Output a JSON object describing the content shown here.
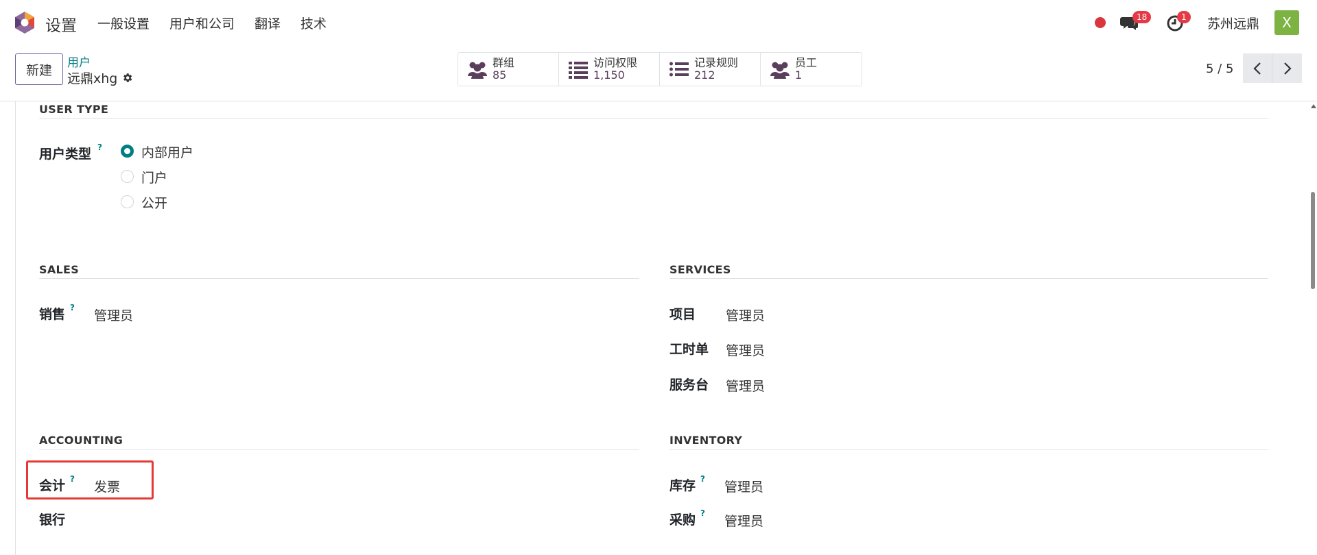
{
  "navbar": {
    "app_title": "设置",
    "menu": [
      "一般设置",
      "用户和公司",
      "翻译",
      "技术"
    ],
    "messages_badge": "18",
    "activity_badge": "1",
    "company": "苏州远鼎",
    "avatar_letter": "X",
    "icons": [
      "odoo-logo-icon",
      "recording-dot-icon",
      "chat-icon",
      "clock-icon"
    ]
  },
  "control": {
    "new_button": "新建",
    "breadcrumb": "用户",
    "record_name": "远鼎xhg",
    "smart_buttons": [
      {
        "label": "群组",
        "value": "85",
        "icon": "users-icon"
      },
      {
        "label": "访问权限",
        "value": "1,150",
        "icon": "list-icon"
      },
      {
        "label": "记录规则",
        "value": "212",
        "icon": "list-icon"
      },
      {
        "label": "员工",
        "value": "1",
        "icon": "users-icon"
      }
    ],
    "pager": "5 / 5"
  },
  "user_type": {
    "title": "USER TYPE",
    "label": "用户类型",
    "help": "?",
    "options": [
      "内部用户",
      "门户",
      "公开"
    ],
    "selected": "内部用户"
  },
  "sales": {
    "title": "SALES",
    "fields": [
      {
        "label": "销售",
        "help": "?",
        "value": "管理员"
      }
    ]
  },
  "services": {
    "title": "SERVICES",
    "fields": [
      {
        "label": "项目",
        "value": "管理员"
      },
      {
        "label": "工时单",
        "value": "管理员"
      },
      {
        "label": "服务台",
        "value": "管理员"
      }
    ]
  },
  "accounting": {
    "title": "ACCOUNTING",
    "fields": [
      {
        "label": "会计",
        "help": "?",
        "value": "发票"
      },
      {
        "label": "银行",
        "value": ""
      }
    ]
  },
  "inventory": {
    "title": "INVENTORY",
    "fields": [
      {
        "label": "库存",
        "help": "?",
        "value": "管理员"
      },
      {
        "label": "采购",
        "help": "?",
        "value": "管理员"
      }
    ]
  },
  "colors": {
    "primary": "#71639e",
    "teal": "#017e84",
    "badge_red": "#e53946",
    "highlight_red": "#e53935",
    "avatar_green": "#7cb342"
  }
}
